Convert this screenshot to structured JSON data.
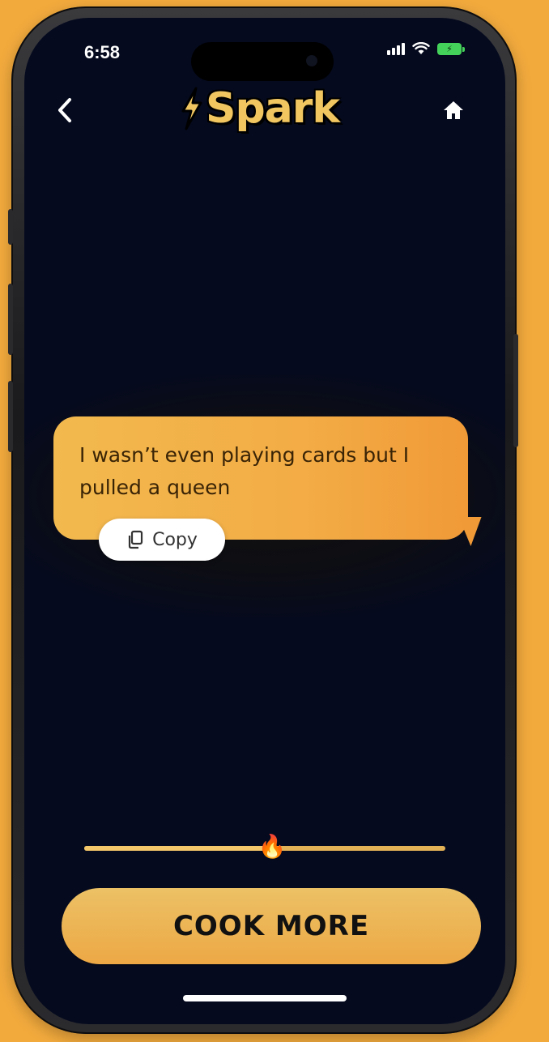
{
  "status_bar": {
    "time": "6:58",
    "icons": [
      "cellular-signal-icon",
      "wifi-icon",
      "battery-charging-icon"
    ]
  },
  "header": {
    "logo_text": "Spark",
    "back_icon": "chevron-left-icon",
    "home_icon": "home-icon"
  },
  "message": {
    "text": "I wasn’t even playing cards but I pulled a queen",
    "copy_label": "Copy",
    "copy_icon": "copy-icon"
  },
  "spice_slider": {
    "value_fraction": 0.52,
    "thumb_icon": "fire-emoji-icon"
  },
  "primary_action": {
    "label": "COOK MORE"
  },
  "colors": {
    "background": "#f2aa3d",
    "screen": "#050a1e",
    "accent": "#f1c661",
    "bubble": "#f3ac46"
  }
}
